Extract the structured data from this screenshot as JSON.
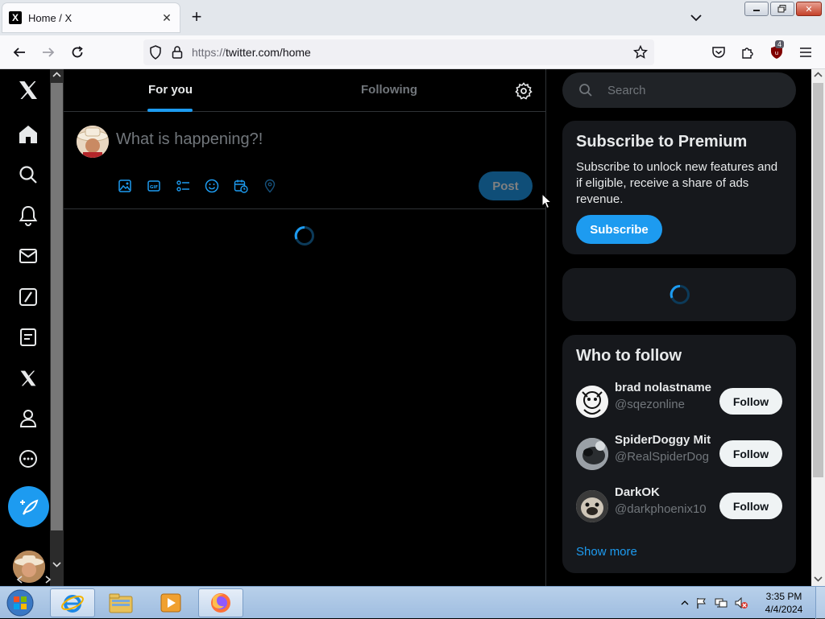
{
  "browser": {
    "tab_title": "Home / X",
    "tab_favicon": "X",
    "url_protocol": "https://",
    "url_rest": "twitter.com/home",
    "extension_badge": "4"
  },
  "timeline": {
    "tab_for_you": "For you",
    "tab_following": "Following",
    "composer_placeholder": "What is happening?!",
    "post_label": "Post"
  },
  "sidebar": {
    "search_placeholder": "Search",
    "premium": {
      "title": "Subscribe to Premium",
      "body": "Subscribe to unlock new features and if eligible, receive a share of ads revenue.",
      "button": "Subscribe"
    },
    "who_to_follow": {
      "title": "Who to follow",
      "follow_label": "Follow",
      "users": [
        {
          "name": "brad nolastname",
          "handle": "@sqezonline"
        },
        {
          "name": "SpiderDoggy Mit",
          "handle": "@RealSpiderDog"
        },
        {
          "name": "DarkOK",
          "handle": "@darkphoenix10"
        }
      ],
      "show_more": "Show more"
    }
  },
  "taskbar": {
    "time": "3:35 PM",
    "date": "4/4/2024"
  },
  "colors": {
    "accent": "#1d9bf0",
    "background": "#000000",
    "card": "#16181c"
  }
}
